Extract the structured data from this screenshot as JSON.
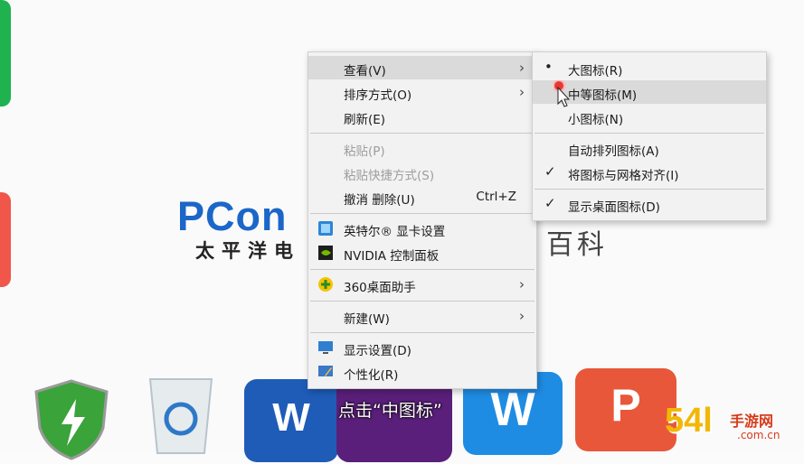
{
  "wallpaper": {
    "logo_main": "PCon",
    "logo_sub": "太平洋电",
    "logo_right": "百科"
  },
  "context_menu": {
    "items": [
      {
        "label": "查看(V)",
        "submenu": true
      },
      {
        "label": "排序方式(O)",
        "submenu": true
      },
      {
        "label": "刷新(E)"
      },
      {
        "label": "粘贴(P)",
        "disabled": true
      },
      {
        "label": "粘贴快捷方式(S)",
        "disabled": true
      },
      {
        "label": "撤消 删除(U)",
        "shortcut": "Ctrl+Z"
      },
      {
        "label": "英特尔® 显卡设置",
        "icon": "intel-graphics-icon"
      },
      {
        "label": "NVIDIA 控制面板",
        "icon": "nvidia-icon"
      },
      {
        "label": "360桌面助手",
        "icon": "360-desktop-icon",
        "submenu": true
      },
      {
        "label": "新建(W)",
        "submenu": true
      },
      {
        "label": "显示设置(D)",
        "icon": "display-settings-icon"
      },
      {
        "label": "个性化(R)",
        "icon": "personalize-icon"
      }
    ]
  },
  "view_submenu": {
    "items": [
      {
        "label": "大图标(R)",
        "mark": "bullet"
      },
      {
        "label": "中等图标(M)",
        "highlighted": true
      },
      {
        "label": "小图标(N)"
      },
      {
        "label": "自动排列图标(A)"
      },
      {
        "label": "将图标与网格对齐(I)",
        "mark": "check"
      },
      {
        "label": "显示桌面图标(D)",
        "mark": "check"
      }
    ]
  },
  "dock": {
    "word_glyph": "W",
    "wps_glyph": "W",
    "pdf_glyph": "P"
  },
  "caption": "点击“中图标”",
  "watermark": {
    "number": "54l",
    "cn": "手游网",
    "domain": ".com.cn"
  },
  "colors": {
    "menu_bg": "#f2f2f2",
    "highlight": "#dadada",
    "click_marker": "#e53935"
  }
}
